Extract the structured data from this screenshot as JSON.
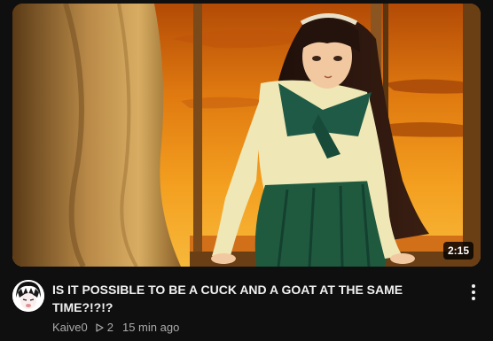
{
  "video": {
    "duration": "2:15",
    "title": "IS IT POSSIBLE TO BE A CUCK AND A GOAT AT THE SAME TIME?!?!?",
    "channel": "Kaive0",
    "views": "2",
    "age": "15 min ago"
  },
  "icons": {
    "views": "play-outline-icon",
    "menu": "more-vertical-icon"
  },
  "colors": {
    "background": "#0f0f0f",
    "title": "#f1f1f1",
    "meta": "#aaaaaa",
    "sunset": "#e8891e"
  }
}
